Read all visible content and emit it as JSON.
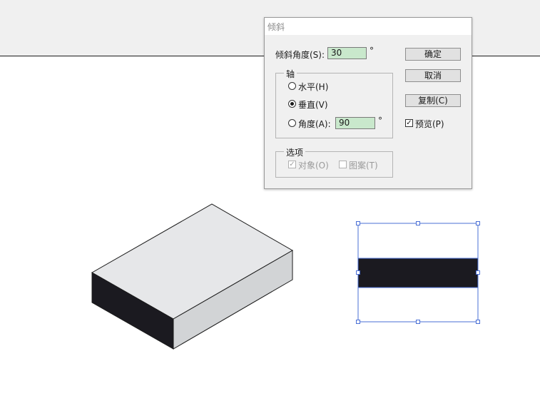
{
  "dialog": {
    "title": "倾斜",
    "angle_label": "倾斜角度(S):",
    "angle_value": "30",
    "degree_symbol": "°",
    "axis_group_label": "轴",
    "axis_options": [
      {
        "label": "水平(H)",
        "selected": false
      },
      {
        "label": "垂直(V)",
        "selected": true
      },
      {
        "label": "角度(A):",
        "selected": false
      }
    ],
    "axis_angle_value": "90",
    "options_group_label": "选项",
    "options": [
      {
        "label": "对象(O)",
        "checked": true,
        "disabled": true
      },
      {
        "label": "图案(T)",
        "checked": false,
        "disabled": true
      }
    ],
    "buttons": {
      "ok": "确定",
      "cancel": "取消",
      "copy": "复制(C)"
    },
    "preview": {
      "label": "预览(P)",
      "checked": true
    }
  },
  "colors": {
    "field_bg": "#c9e8cc",
    "selection_blue": "#4a6fd6",
    "box_top": "#e6e7e9",
    "box_right": "#d2d4d6",
    "box_left": "#1b1a20"
  }
}
